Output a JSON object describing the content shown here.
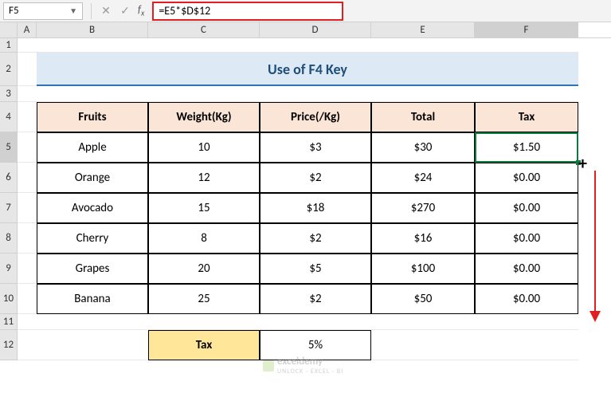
{
  "namebox": "F5",
  "formula": "=E5*$D$12",
  "columns": [
    "A",
    "B",
    "C",
    "D",
    "E",
    "F"
  ],
  "rows": [
    "1",
    "2",
    "3",
    "4",
    "5",
    "6",
    "7",
    "8",
    "9",
    "10",
    "11",
    "12"
  ],
  "title": "Use of F4 Key",
  "headers": {
    "b": "Fruits",
    "c": "Weight(Kg)",
    "d": "Price(/Kg)",
    "e": "Total",
    "f": "Tax"
  },
  "data": [
    {
      "fruit": "Apple",
      "weight": "10",
      "price": "$3",
      "total": "$30",
      "tax": "$1.50"
    },
    {
      "fruit": "Orange",
      "weight": "12",
      "price": "$2",
      "total": "$24",
      "tax": "$0.00"
    },
    {
      "fruit": "Avocado",
      "weight": "15",
      "price": "$18",
      "total": "$270",
      "tax": "$0.00"
    },
    {
      "fruit": "Cherry",
      "weight": "8",
      "price": "$2",
      "total": "$16",
      "tax": "$0.00"
    },
    {
      "fruit": "Grapes",
      "weight": "20",
      "price": "$5",
      "total": "$100",
      "tax": "$0.00"
    },
    {
      "fruit": "Banana",
      "weight": "25",
      "price": "$2",
      "total": "$50",
      "tax": "$0.00"
    }
  ],
  "tax_row": {
    "label": "Tax",
    "value": "5%"
  },
  "watermark": "exceldemy",
  "watermark_sub": "UNLOCK · EXCEL · BI"
}
